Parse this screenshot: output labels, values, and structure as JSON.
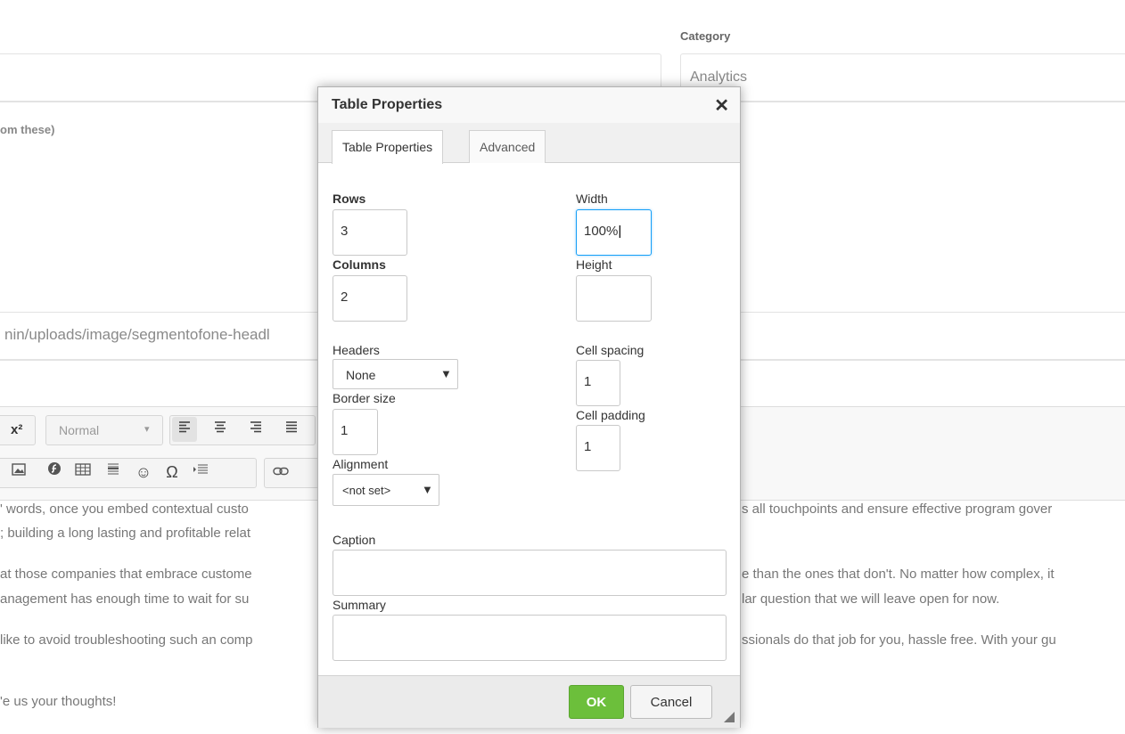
{
  "background": {
    "category_label": "Category",
    "category_value": "Analytics",
    "hint_text": "om these)",
    "image_path": "nin/uploads/image/segmentofone-headl",
    "toolbar": {
      "superscript_icon": "superscript-icon",
      "format_value": "Normal",
      "row2_icons": [
        "image-icon",
        "flash-icon",
        "table-icon",
        "horizontal-line-icon",
        "smiley-icon",
        "omega-icon",
        "iframe-icon",
        "link-icon"
      ]
    },
    "paragraphs": [
      "' words, once you embed contextual custo",
      "; building a long lasting and profitable relat",
      "at those companies that embrace custome",
      "anagement has enough time to wait for su",
      " like to avoid troubleshooting such an comp",
      "'e us your thoughts!"
    ],
    "paragraphs_right": [
      "s all touchpoints and ensure effective program gover",
      "e than the ones that don't. No matter how complex, it",
      "lar question that we will leave open for now.",
      "ssionals do that job for you, hassle free. With your gu"
    ]
  },
  "dialog": {
    "title": "Table Properties",
    "close_icon": "close-icon",
    "tabs": [
      {
        "label": "Table Properties",
        "selected": true
      },
      {
        "label": "Advanced",
        "selected": false
      }
    ],
    "rows_label": "Rows",
    "rows_value": "3",
    "columns_label": "Columns",
    "columns_value": "2",
    "width_label": "Width",
    "width_value": "100%",
    "height_label": "Height",
    "height_value": "",
    "headers_label": "Headers",
    "headers_value": "None",
    "border_label": "Border size",
    "border_value": "1",
    "alignment_label": "Alignment",
    "alignment_value": "<not set>",
    "cell_spacing_label": "Cell spacing",
    "cell_spacing_value": "1",
    "cell_padding_label": "Cell padding",
    "cell_padding_value": "1",
    "caption_label": "Caption",
    "caption_value": "",
    "summary_label": "Summary",
    "summary_value": "",
    "ok_label": "OK",
    "cancel_label": "Cancel"
  }
}
